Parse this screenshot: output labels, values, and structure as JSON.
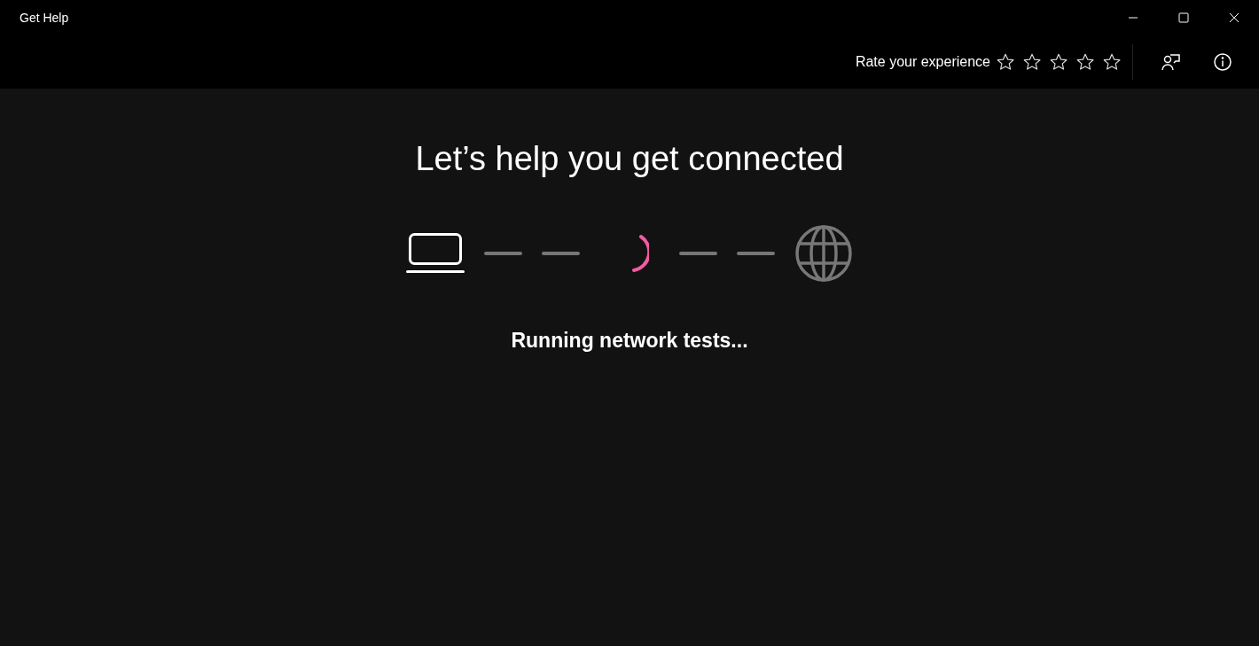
{
  "window": {
    "title": "Get Help"
  },
  "header": {
    "rating_label": "Rate your experience",
    "stars": 0
  },
  "main": {
    "heading": "Let’s help you get connected",
    "status": "Running network tests..."
  }
}
